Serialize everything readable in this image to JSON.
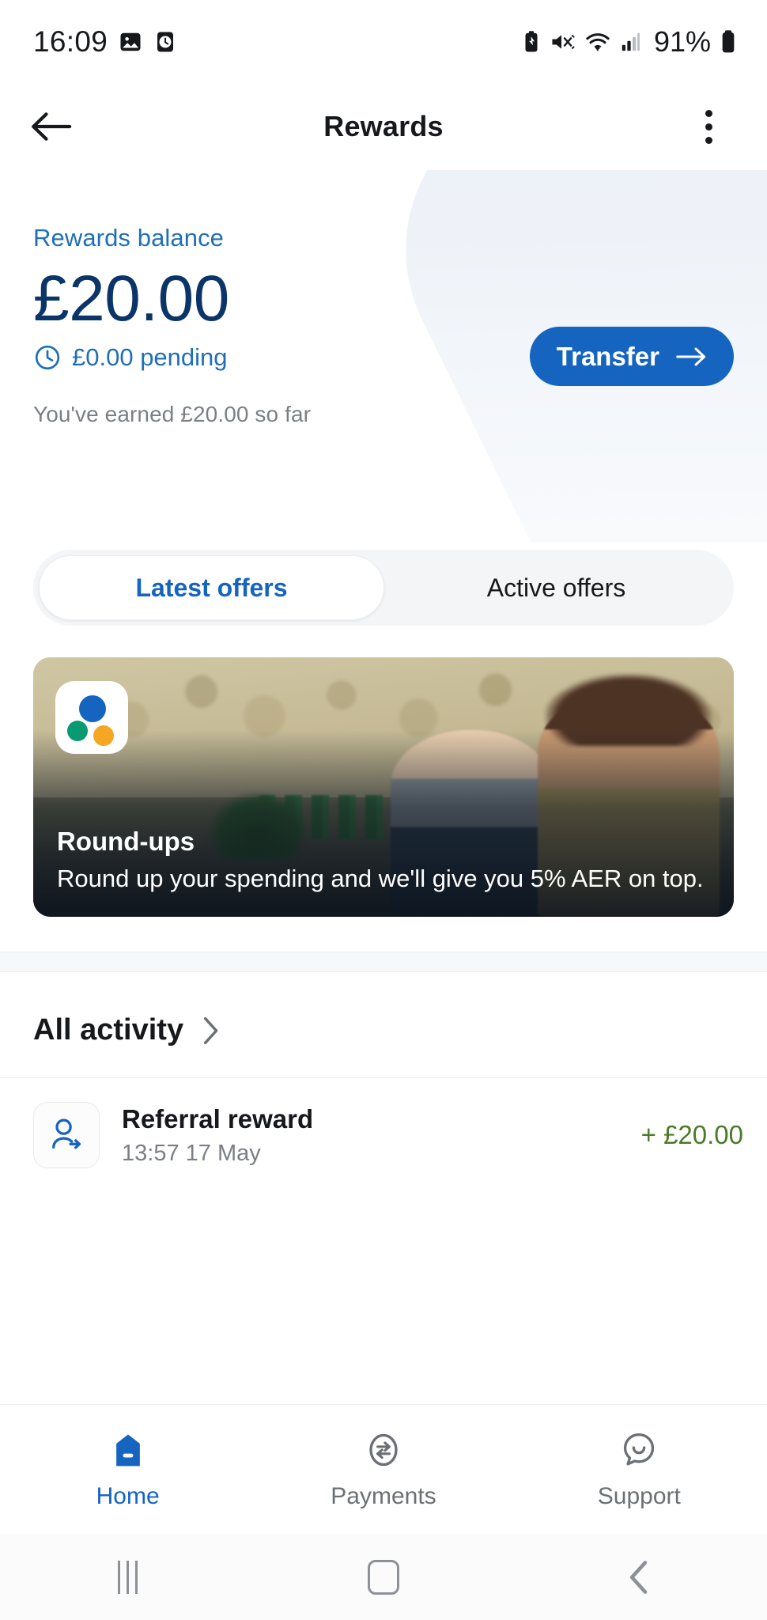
{
  "status_bar": {
    "time": "16:09",
    "battery_percent": "91%",
    "icons": [
      "photo-icon",
      "clock-icon",
      "battery-saver-icon",
      "mute-icon",
      "wifi-icon",
      "signal-icon",
      "battery-icon"
    ]
  },
  "app_bar": {
    "title": "Rewards",
    "back_icon": "back-arrow-icon",
    "menu_icon": "kebab-menu-icon"
  },
  "hero": {
    "balance_label": "Rewards balance",
    "balance_amount": "£20.00",
    "pending_text": "£0.00 pending",
    "pending_icon": "clock-icon",
    "earned_text": "You've earned £20.00 so far",
    "transfer_label": "Transfer",
    "transfer_arrow": "→"
  },
  "tabs": [
    {
      "label": "Latest offers",
      "active": true
    },
    {
      "label": "Active offers",
      "active": false
    }
  ],
  "offer_card": {
    "brand_icon": "brand-dots-logo",
    "title": "Round-ups",
    "subtitle": "Round up your spending and we'll give you 5% AER on top."
  },
  "activity": {
    "heading": "All activity",
    "chevron_icon": "chevron-right-icon",
    "rows": [
      {
        "icon": "referral-person-icon",
        "title": "Referral reward",
        "date": "13:57 17 May",
        "amount": "+ £20.00"
      }
    ]
  },
  "bottom_nav": [
    {
      "label": "Home",
      "icon": "home-icon",
      "active": true
    },
    {
      "label": "Payments",
      "icon": "payments-transfer-icon",
      "active": false
    },
    {
      "label": "Support",
      "icon": "support-chat-icon",
      "active": false
    }
  ],
  "system_nav": {
    "recents": "recents-icon",
    "home": "home-square-icon",
    "back": "back-chevron-icon"
  },
  "colors": {
    "accent_blue": "#1464c0",
    "navy": "#0b3568",
    "link_blue": "#1f6fb8",
    "green_amount": "#4a7b28",
    "muted_text": "#7b7f85"
  }
}
